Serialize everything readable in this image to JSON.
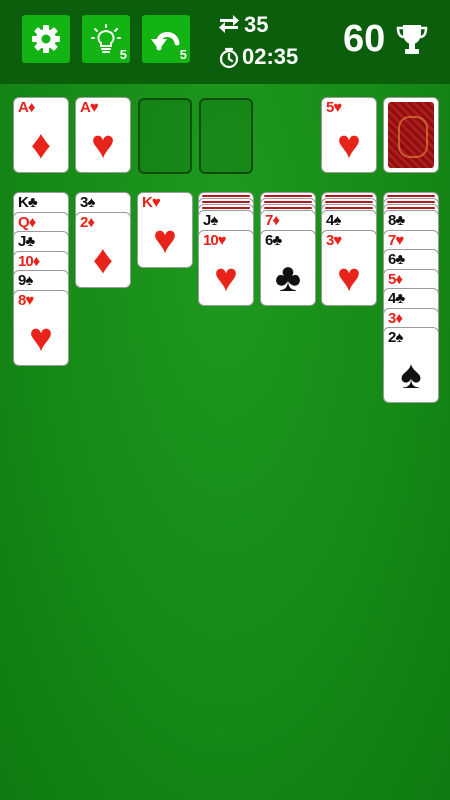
{
  "toolbar": {
    "settings_icon": "gear-icon",
    "hint_icon": "lightbulb-icon",
    "hint_count": "5",
    "undo_icon": "undo-arrow-icon",
    "undo_count": "5"
  },
  "stats": {
    "moves_icon": "swap-arrows-icon",
    "moves": "35",
    "timer_icon": "stopwatch-icon",
    "time": "02:35",
    "score": "60",
    "score_icon": "trophy-icon"
  },
  "colors": {
    "felt": "#168a16",
    "topbar": "#0b5e0b",
    "button": "#13b313",
    "red_suit": "#e8231a",
    "black_suit": "#111111"
  },
  "foundations": [
    {
      "rank": "A",
      "suit": "♦",
      "color": "red"
    },
    {
      "rank": "A",
      "suit": "♥",
      "color": "red"
    },
    {
      "empty": true
    },
    {
      "empty": true
    }
  ],
  "waste": {
    "rank": "5",
    "suit": "♥",
    "color": "red"
  },
  "stock": {
    "face_down": true
  },
  "tableau": [
    {
      "hidden": 0,
      "cards": [
        {
          "rank": "K",
          "suit": "♣",
          "color": "black"
        },
        {
          "rank": "Q",
          "suit": "♦",
          "color": "red"
        },
        {
          "rank": "J",
          "suit": "♣",
          "color": "black"
        },
        {
          "rank": "10",
          "suit": "♦",
          "color": "red"
        },
        {
          "rank": "9",
          "suit": "♠",
          "color": "black"
        },
        {
          "rank": "8",
          "suit": "♥",
          "color": "red"
        }
      ]
    },
    {
      "hidden": 0,
      "cards": [
        {
          "rank": "3",
          "suit": "♠",
          "color": "black"
        },
        {
          "rank": "2",
          "suit": "♦",
          "color": "red"
        }
      ]
    },
    {
      "hidden": 0,
      "cards": [
        {
          "rank": "K",
          "suit": "♥",
          "color": "red"
        }
      ]
    },
    {
      "hidden": 3,
      "cards": [
        {
          "rank": "J",
          "suit": "♠",
          "color": "black"
        },
        {
          "rank": "10",
          "suit": "♥",
          "color": "red"
        }
      ]
    },
    {
      "hidden": 3,
      "cards": [
        {
          "rank": "7",
          "suit": "♦",
          "color": "red"
        },
        {
          "rank": "6",
          "suit": "♣",
          "color": "black"
        }
      ]
    },
    {
      "hidden": 3,
      "cards": [
        {
          "rank": "4",
          "suit": "♠",
          "color": "black"
        },
        {
          "rank": "3",
          "suit": "♥",
          "color": "red"
        }
      ]
    },
    {
      "hidden": 3,
      "cards": [
        {
          "rank": "8",
          "suit": "♣",
          "color": "black"
        },
        {
          "rank": "7",
          "suit": "♥",
          "color": "red"
        },
        {
          "rank": "6",
          "suit": "♣",
          "color": "black"
        },
        {
          "rank": "5",
          "suit": "♦",
          "color": "red"
        },
        {
          "rank": "4",
          "suit": "♣",
          "color": "black"
        },
        {
          "rank": "3",
          "suit": "♦",
          "color": "red"
        },
        {
          "rank": "2",
          "suit": "♠",
          "color": "black"
        }
      ]
    }
  ]
}
